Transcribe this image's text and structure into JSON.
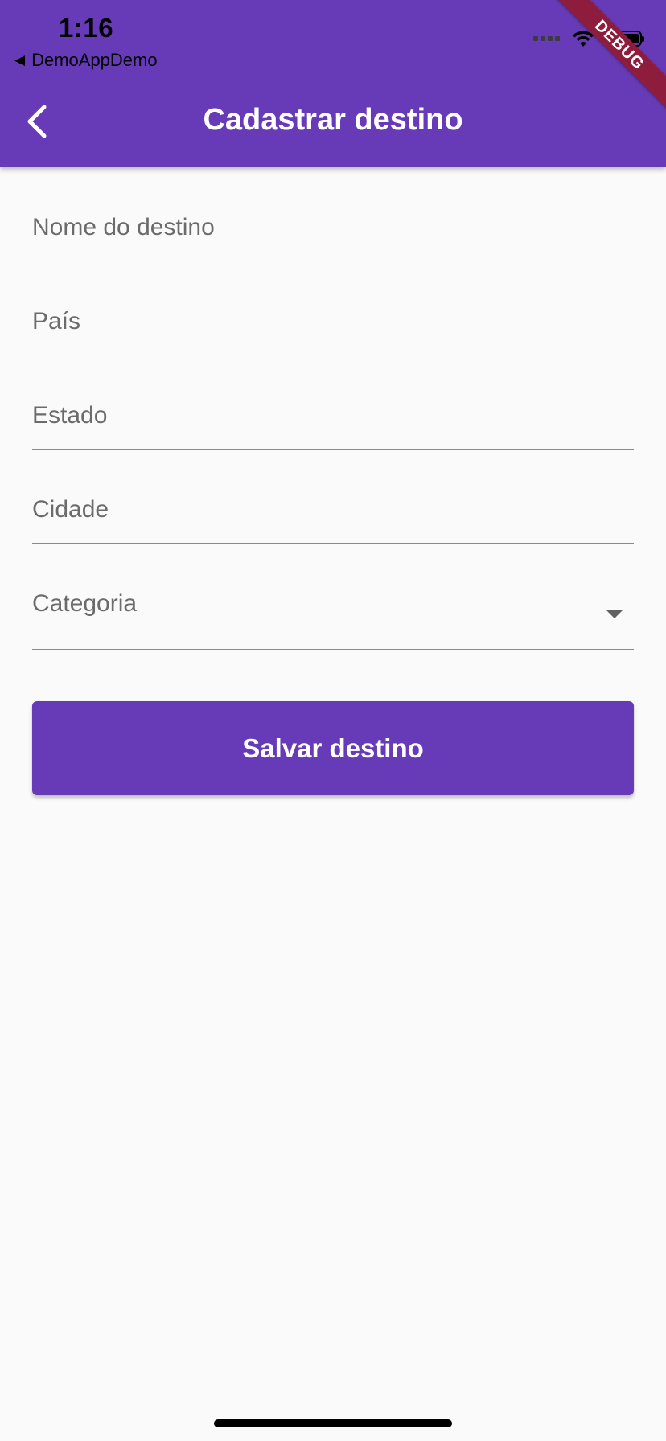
{
  "status_bar": {
    "time": "1:16",
    "back_app_label": "DemoAppDemo"
  },
  "app_bar": {
    "title": "Cadastrar destino",
    "background_color": "#673ab7"
  },
  "debug_banner": {
    "label": "DEBUG"
  },
  "form": {
    "fields": [
      {
        "placeholder": "Nome do destino"
      },
      {
        "placeholder": "País"
      },
      {
        "placeholder": "Estado"
      },
      {
        "placeholder": "Cidade"
      }
    ],
    "category": {
      "label": "Categoria"
    },
    "save_label": "Salvar destino"
  },
  "icons": {
    "back": "chevron-left-icon",
    "dropdown": "caret-down-icon",
    "wifi": "wifi-icon",
    "battery": "battery-icon",
    "signal": "cellular-signal-icon"
  }
}
